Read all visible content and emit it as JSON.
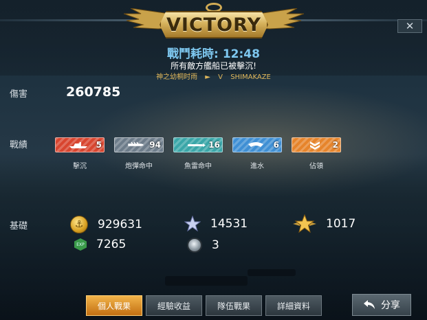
{
  "header": {
    "title": "VICTORY",
    "battle_time_label": "戰鬥耗時:",
    "battle_time_value": "12:48",
    "result_message": "所有敵方艦船已被擊沉!",
    "player_name": "神之幼桐时雨",
    "arrow": "►",
    "versus": "V",
    "opponent_name": "SHIMAKAZE",
    "close": "✕"
  },
  "damage": {
    "label": "傷害",
    "value": "260785"
  },
  "achievements": {
    "label": "戰績",
    "items": [
      {
        "label": "擊沉",
        "count": "5",
        "color": "#d8452f",
        "icon": "aircraft-carrier-icon"
      },
      {
        "label": "炮彈命中",
        "count": "94",
        "color": "#6d7c8a",
        "icon": "shell-icon"
      },
      {
        "label": "魚雷命中",
        "count": "16",
        "color": "#3aa6a8",
        "icon": "torpedo-icon"
      },
      {
        "label": "進水",
        "count": "6",
        "color": "#3f8fd4",
        "icon": "flooding-icon"
      },
      {
        "label": "佔領",
        "count": "2",
        "color": "#e6842b",
        "icon": "rank-chevron-icon"
      }
    ]
  },
  "basics": {
    "label": "基礎",
    "coins": {
      "value": "929631",
      "icon": "gold-coin-icon"
    },
    "exp": {
      "value": "7265",
      "icon": "exp-icon",
      "icon_text": "EXP"
    },
    "silver_star": {
      "value": "14531",
      "icon": "silver-star-icon"
    },
    "gear": {
      "value": "3",
      "icon": "gear-icon"
    },
    "gold_star": {
      "value": "1017",
      "icon": "gold-star-icon"
    }
  },
  "tabs": [
    {
      "label": "個人戰果",
      "active": true
    },
    {
      "label": "經驗收益",
      "active": false
    },
    {
      "label": "隊伍戰果",
      "active": false
    },
    {
      "label": "詳細資料",
      "active": false
    }
  ],
  "share": {
    "label": "分享"
  }
}
